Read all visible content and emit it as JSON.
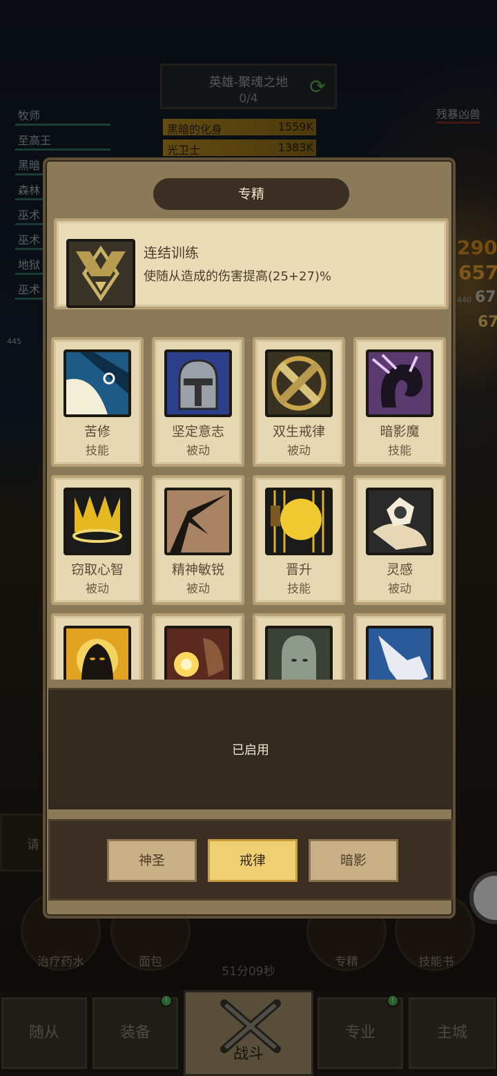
{
  "zone": {
    "title": "英雄-聚魂之地",
    "progress": "0/4"
  },
  "bosses": [
    {
      "name": "黑暗的化身",
      "value": "1559K"
    },
    {
      "name": "光卫士",
      "value": "1383K"
    }
  ],
  "party": [
    "牧师",
    "至高王",
    "黑暗",
    "森林",
    "巫术",
    "巫术",
    "地狱",
    "巫术"
  ],
  "enemy_label": "残暴凶兽",
  "damage_numbers": [
    "290",
    "657",
    "67",
    "67",
    "440",
    "445"
  ],
  "modal": {
    "title": "专精",
    "detail": {
      "name": "连结训练",
      "description": "使随从造成的伤害提高(25+27)%"
    },
    "skills": [
      {
        "name": "苦修",
        "type": "技能",
        "icon": "penance-icon"
      },
      {
        "name": "坚定意志",
        "type": "被动",
        "icon": "helmet-icon"
      },
      {
        "name": "双生戒律",
        "type": "被动",
        "icon": "crossed-swords-icon"
      },
      {
        "name": "暗影魔",
        "type": "技能",
        "icon": "shadowfiend-icon"
      },
      {
        "name": "窃取心智",
        "type": "被动",
        "icon": "crown-icon"
      },
      {
        "name": "精神敏锐",
        "type": "被动",
        "icon": "branch-icon"
      },
      {
        "name": "晋升",
        "type": "技能",
        "icon": "golden-fist-icon"
      },
      {
        "name": "灵感",
        "type": "被动",
        "icon": "hand-gem-icon"
      },
      {
        "name": "",
        "type": "",
        "icon": "shadow-figure-icon"
      },
      {
        "name": "",
        "type": "",
        "icon": "holy-burst-icon"
      },
      {
        "name": "",
        "type": "",
        "icon": "spirit-icon"
      },
      {
        "name": "",
        "type": "",
        "icon": "pointing-hand-icon"
      }
    ],
    "status": "已启用",
    "spec_tabs": [
      {
        "label": "神圣",
        "selected": false
      },
      {
        "label": "戒律",
        "selected": true
      },
      {
        "label": "暗影",
        "selected": false
      }
    ]
  },
  "hud": {
    "potion_label": "治疗药水",
    "bread_label": "面包",
    "timer": "51分09秒",
    "spec_label": "专精",
    "skillbook_label": "技能书",
    "request_label": "请"
  },
  "bottom_tabs": [
    "随从",
    "装备",
    "战斗",
    "专业",
    "主城"
  ],
  "colors": {
    "accent_selected": "#f0cf73",
    "panel_dark": "#332a1f",
    "card": "#e6d8b2"
  }
}
